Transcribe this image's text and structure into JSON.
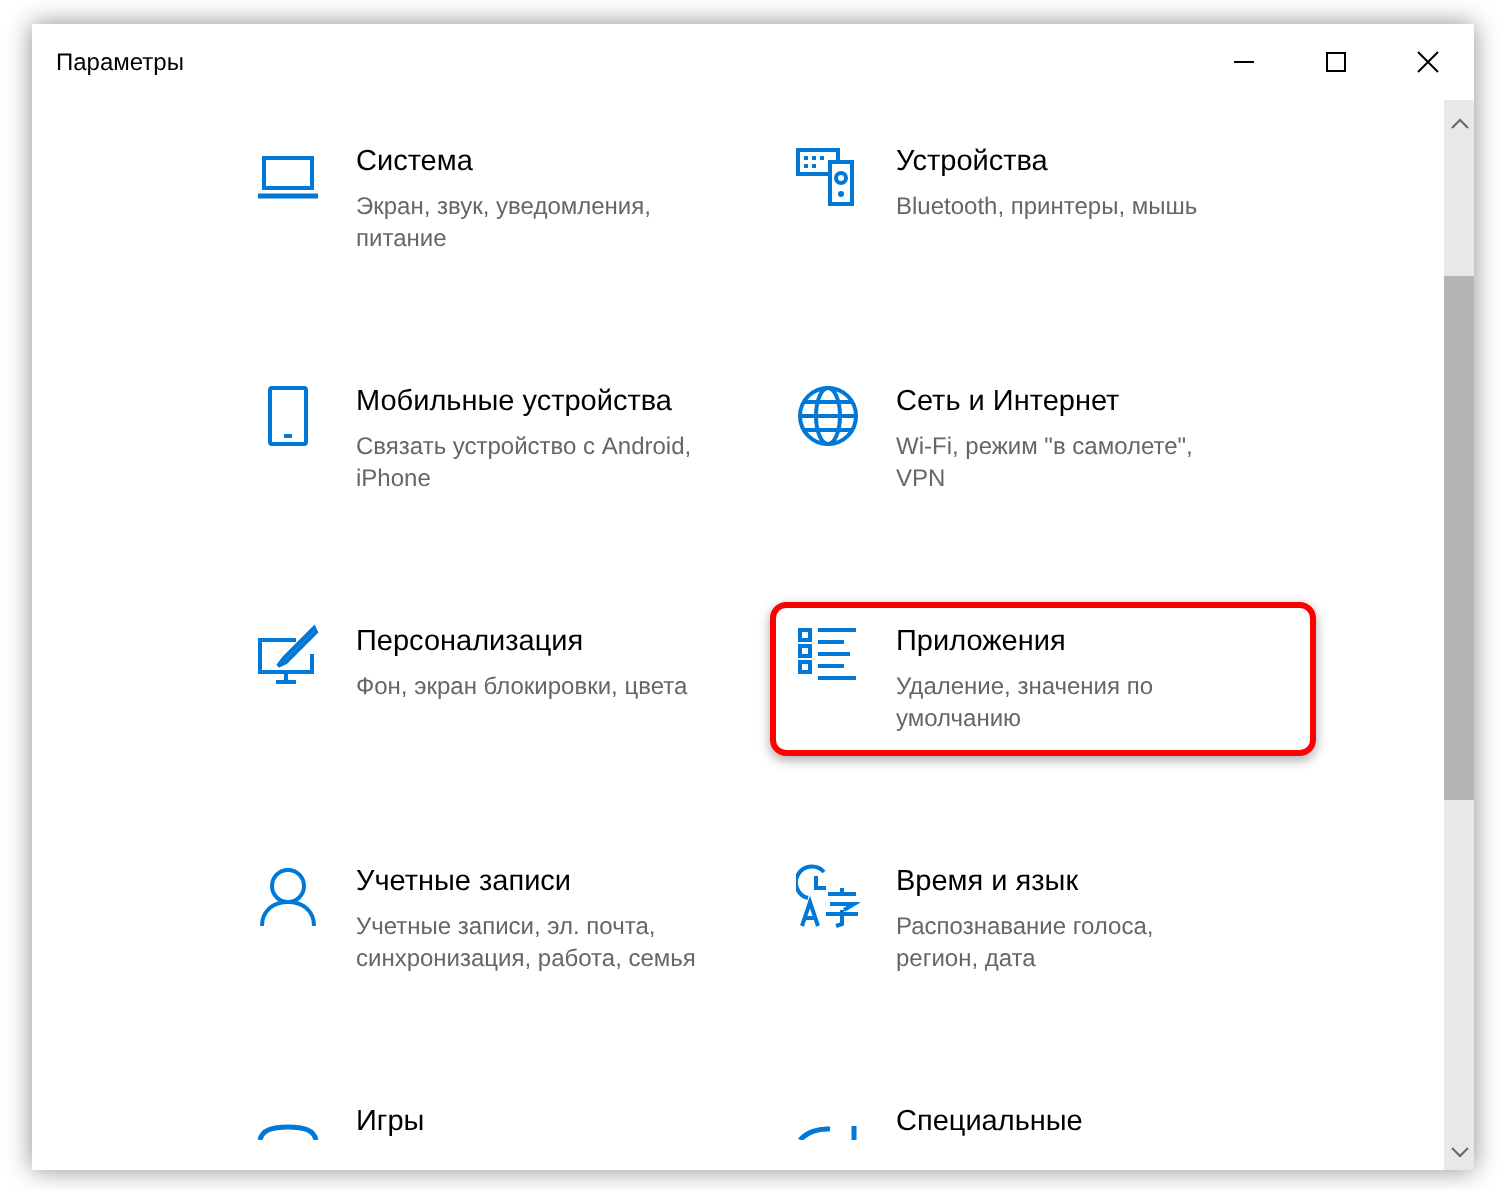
{
  "window": {
    "title": "Параметры"
  },
  "items": [
    {
      "kind": "tile",
      "title": "Система",
      "description": "Экран, звук, уведомления, питание",
      "highlighted": false
    },
    {
      "kind": "tile",
      "title": "Устройства",
      "description": "Bluetooth, принтеры, мышь",
      "highlighted": false
    },
    {
      "kind": "tile",
      "title": "Мобильные устройства",
      "description": "Связать устройство с Android, iPhone",
      "highlighted": false
    },
    {
      "kind": "tile",
      "title": "Сеть и Интернет",
      "description": "Wi-Fi, режим \"в самолете\", VPN",
      "highlighted": false
    },
    {
      "kind": "tile",
      "title": "Персонализация",
      "description": "Фон, экран блокировки, цвета",
      "highlighted": false
    },
    {
      "kind": "tile",
      "title": "Приложения",
      "description": "Удаление, значения по умолчанию",
      "highlighted": true
    },
    {
      "kind": "tile",
      "title": "Учетные записи",
      "description": "Учетные записи, эл. почта, синхронизация, работа, семья",
      "highlighted": false
    },
    {
      "kind": "tile",
      "title": "Время и язык",
      "description": "Распознавание голоса, регион, дата",
      "highlighted": false
    },
    {
      "kind": "cut",
      "title": "Игры",
      "highlighted": false
    },
    {
      "kind": "cut",
      "title": "Специальные",
      "highlighted": false
    }
  ]
}
